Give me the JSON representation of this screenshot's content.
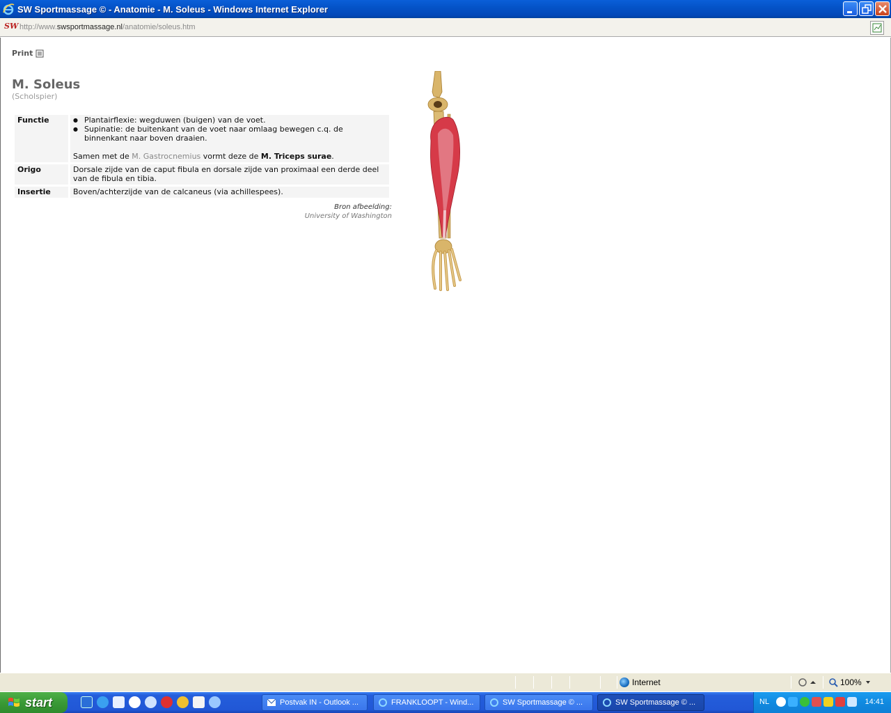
{
  "window": {
    "title": "SW Sportmassage © - Anatomie - M. Soleus - Windows Internet Explorer"
  },
  "address": {
    "site_icon": "SW",
    "url_prefix": "http://www.",
    "url_host": "swsportmassage.nl",
    "url_path": "/anatomie/soleus.htm"
  },
  "page": {
    "print_label": "Print",
    "title": "M. Soleus",
    "subtitle": "(Scholspier)",
    "table": {
      "functie_label": "Functie",
      "functie_items": [
        "Plantairflexie: wegduwen (buigen) van de voet.",
        "Supinatie: de buitenkant van de voet naar omlaag bewegen c.q. de binnenkant naar boven draaien."
      ],
      "functie_note_pre": "Samen met de ",
      "functie_note_link": "M. Gastrocnemius",
      "functie_note_mid": " vormt deze de ",
      "functie_note_bold": "M. Triceps surae",
      "functie_note_end": ".",
      "origo_label": "Origo",
      "origo_text": "Dorsale zijde van de caput fibula en dorsale zijde van proximaal een derde deel van de fibula en tibia.",
      "insertie_label": "Insertie",
      "insertie_text": "Boven/achterzijde van de calcaneus (via achillespees)."
    },
    "source_label": "Bron afbeelding:",
    "source_name": "University of Washington"
  },
  "statusbar": {
    "zone": "Internet",
    "zoom": "100%"
  },
  "taskbar": {
    "start_label": "start",
    "tasks": [
      "Postvak IN - Outlook ...",
      "FRANKLOOPT - Wind...",
      "SW Sportmassage © ...",
      "SW Sportmassage © ..."
    ],
    "lang": "NL",
    "clock": "14:41"
  },
  "colors": {
    "titlebar": "#0453c8",
    "taskbar": "#245edb",
    "start": "#3a9a36",
    "muscle": "#d63a48",
    "bone": "#d9b56a"
  }
}
